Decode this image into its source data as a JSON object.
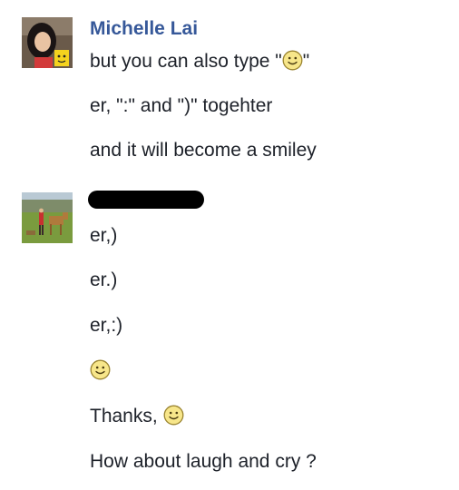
{
  "thread": {
    "sender1": {
      "name": "Michelle Lai",
      "avatar_icon": "profile-photo-girl-with-mug",
      "messages": [
        {
          "before": "but you can also type \"",
          "emoji": "smiley",
          "after": "\""
        },
        {
          "text": "er, \":\" and \")\" togehter"
        },
        {
          "text": "and it will become a smiley"
        }
      ]
    },
    "sender2": {
      "name_redacted": true,
      "avatar_icon": "profile-photo-outdoor-horse",
      "messages": [
        {
          "text": "er,)"
        },
        {
          "text": "er.)"
        },
        {
          "text": "er,:)"
        },
        {
          "emoji": "smiley"
        },
        {
          "text": "Thanks, ",
          "emoji": "smiley"
        },
        {
          "text": "How about laugh and cry ?"
        }
      ]
    }
  },
  "colors": {
    "sender_name": "#365899",
    "text": "#1d2129",
    "smiley_fill": "#f7e68a",
    "smiley_stroke": "#9a8430"
  }
}
